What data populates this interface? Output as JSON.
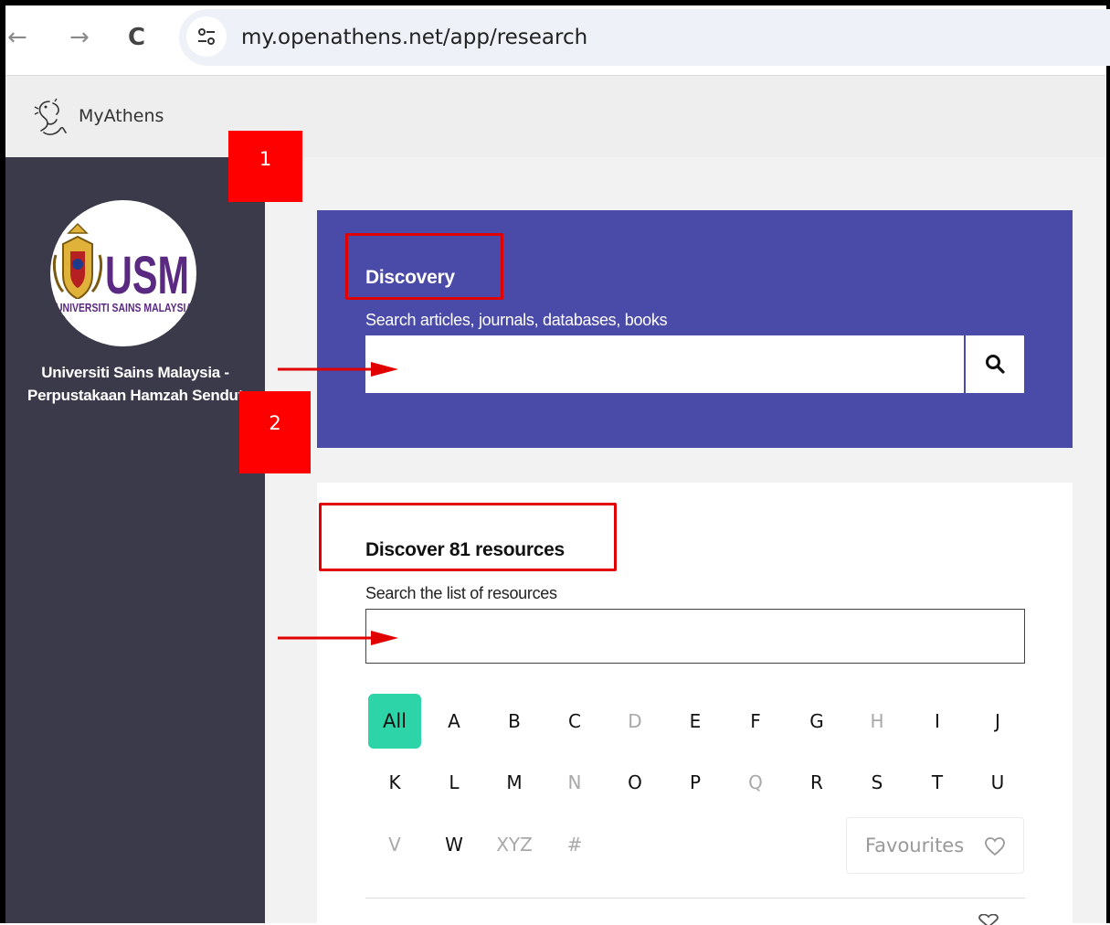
{
  "browser": {
    "url": "my.openathens.net/app/research",
    "back_glyph": "←",
    "forward_glyph": "→",
    "reload_glyph": "C"
  },
  "header": {
    "brand": "MyAthens"
  },
  "sidebar": {
    "org_name_line1": "Universiti Sains Malaysia -",
    "org_name_line2": "Perpustakaan Hamzah Sendut"
  },
  "discovery": {
    "title": "Discovery",
    "subtitle": "Search articles, journals, databases, books",
    "input_value": ""
  },
  "resources": {
    "title": "Discover 81 resources",
    "subtitle": "Search the list of resources",
    "input_value": "",
    "favourites_label": "Favourites"
  },
  "az_filter": [
    {
      "label": "All",
      "state": "active"
    },
    {
      "label": "A",
      "state": "enabled"
    },
    {
      "label": "B",
      "state": "enabled"
    },
    {
      "label": "C",
      "state": "enabled"
    },
    {
      "label": "D",
      "state": "disabled"
    },
    {
      "label": "E",
      "state": "enabled"
    },
    {
      "label": "F",
      "state": "enabled"
    },
    {
      "label": "G",
      "state": "enabled"
    },
    {
      "label": "H",
      "state": "disabled"
    },
    {
      "label": "I",
      "state": "enabled"
    },
    {
      "label": "J",
      "state": "enabled"
    },
    {
      "label": "K",
      "state": "enabled"
    },
    {
      "label": "L",
      "state": "enabled"
    },
    {
      "label": "M",
      "state": "enabled"
    },
    {
      "label": "N",
      "state": "disabled"
    },
    {
      "label": "O",
      "state": "enabled"
    },
    {
      "label": "P",
      "state": "enabled"
    },
    {
      "label": "Q",
      "state": "disabled"
    },
    {
      "label": "R",
      "state": "enabled"
    },
    {
      "label": "S",
      "state": "enabled"
    },
    {
      "label": "T",
      "state": "enabled"
    },
    {
      "label": "U",
      "state": "enabled"
    },
    {
      "label": "V",
      "state": "disabled"
    },
    {
      "label": "W",
      "state": "enabled"
    },
    {
      "label": "XYZ",
      "state": "disabled"
    },
    {
      "label": "#",
      "state": "disabled"
    }
  ],
  "annotations": {
    "marker_1": "1",
    "marker_2": "2"
  },
  "colors": {
    "sidebar": "#3a3a4a",
    "discovery_panel": "#4a4aa8",
    "active_letter": "#2dd4a8",
    "annotation_red": "#ff0000"
  },
  "icons": {
    "site_info": "tune-icon",
    "brand_logo": "athena-logo-icon",
    "discovery_search": "search-icon",
    "favourites": "heart-icon"
  }
}
